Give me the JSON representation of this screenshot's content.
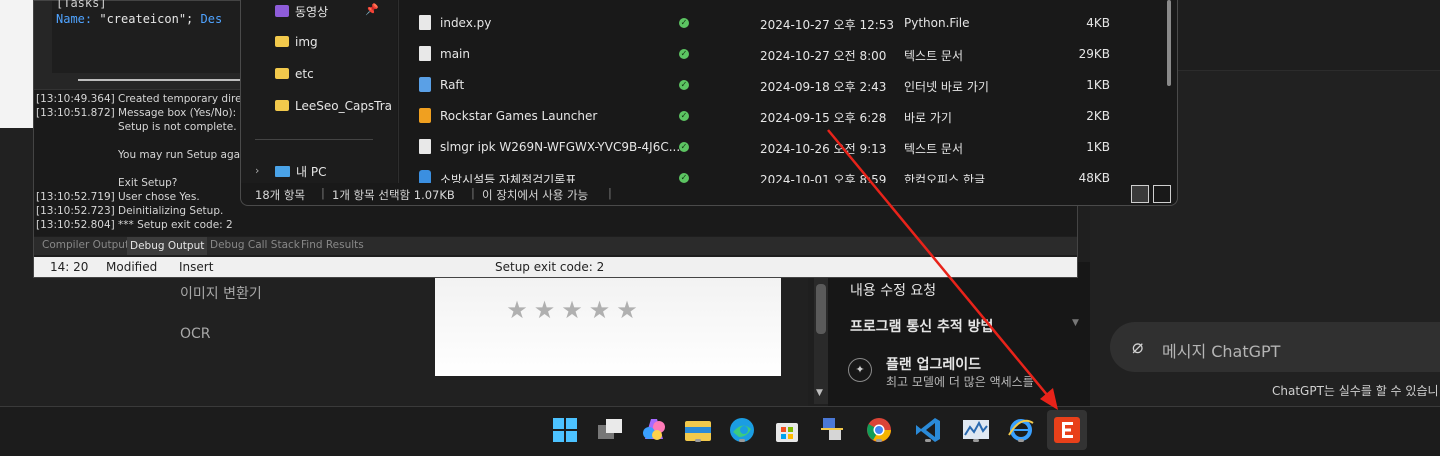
{
  "website": {
    "menu": [
      "이미지 변환기",
      "OCR"
    ],
    "stars": "★★★★★",
    "rating": {
      "value": 0,
      "max": 5
    }
  },
  "chatgpt": {
    "panel": {
      "edit_request": "내용 수정 요청",
      "tracking": "프로그램 통신 추적 방법",
      "upgrade_title": "플랜 업그레이드",
      "upgrade_subtitle": "최고 모델에 더 많은 액세스를"
    },
    "input_placeholder": "메시지 ChatGPT",
    "disclaimer": "ChatGPT는 실수를 할 수 있습니"
  },
  "ide": {
    "code": {
      "line1": "[Tasks]",
      "line2_key": "Name:",
      "line2_value": " \"createicon\";",
      "line2_rest": " Des"
    },
    "log": [
      {
        "time": "[13:10:49.364]",
        "text": "Created temporary direct"
      },
      {
        "time": "[13:10:51.872]",
        "text": "Message box (Yes/No):"
      },
      {
        "time": "",
        "text": "Setup is not complete. If y"
      },
      {
        "time": "",
        "text": ""
      },
      {
        "time": "",
        "text": "You may run Setup again"
      },
      {
        "time": "",
        "text": ""
      },
      {
        "time": "",
        "text": "Exit Setup?"
      },
      {
        "time": "[13:10:52.719]",
        "text": "User chose Yes."
      },
      {
        "time": "[13:10:52.723]",
        "text": "Deinitializing Setup."
      },
      {
        "time": "[13:10:52.804]",
        "text": "*** Setup exit code: 2"
      }
    ],
    "tabs": [
      "Compiler Output",
      "Debug Output",
      "Debug Call Stack",
      "Find Results"
    ],
    "active_tab": "Debug Output",
    "status": {
      "position": "14:  20",
      "modified": "Modified",
      "mode": "Insert",
      "message": "Setup exit code: 2"
    }
  },
  "explorer": {
    "nav": {
      "videos": "동영상",
      "img": "img",
      "etc": "etc",
      "leeseo": "LeeSeo_CapsTra",
      "this_pc": "내 PC"
    },
    "files": [
      {
        "name": "index.py",
        "date": "2024-10-27 오후 12:53",
        "type": "Python.File",
        "size": "4KB",
        "icon": "document-icon"
      },
      {
        "name": "main",
        "date": "2024-10-27 오전 8:00",
        "type": "텍스트 문서",
        "size": "29KB",
        "icon": "document-icon"
      },
      {
        "name": "Raft",
        "date": "2024-09-18 오후 2:43",
        "type": "인터넷 바로 가기",
        "size": "1KB",
        "icon": "internet-shortcut-icon"
      },
      {
        "name": "Rockstar Games Launcher",
        "date": "2024-09-15 오후 6:28",
        "type": "바로 가기",
        "size": "2KB",
        "icon": "rockstar-icon"
      },
      {
        "name": "slmgr ipk W269N-WFGWX-YVC9B-4J6C...",
        "date": "2024-10-26 오전 9:13",
        "type": "텍스트 문서",
        "size": "1KB",
        "icon": "document-icon"
      },
      {
        "name": "소방시설등 자체점검기록표",
        "date": "2024-10-01 오후 8:59",
        "type": "한컴오피스 한글",
        "size": "48KB",
        "icon": "hwp-icon"
      }
    ],
    "status": {
      "count": "18개 항목",
      "selected": "1개 항목 선택함 1.07KB",
      "availability": "이 장치에서 사용 가능"
    }
  },
  "taskbar": {
    "apps": [
      "windows-start-icon",
      "task-view-icon",
      "copilot-icon",
      "file-explorer-icon",
      "edge-icon",
      "store-icon",
      "network-tool-icon",
      "chrome-icon",
      "vscode-icon",
      "performance-monitor-icon",
      "internet-explorer-icon",
      "e-app-icon"
    ]
  },
  "colors": {
    "accent_red": "#e8231a",
    "ok_green": "#5cc462",
    "folder_yellow": "#f2c94c"
  }
}
